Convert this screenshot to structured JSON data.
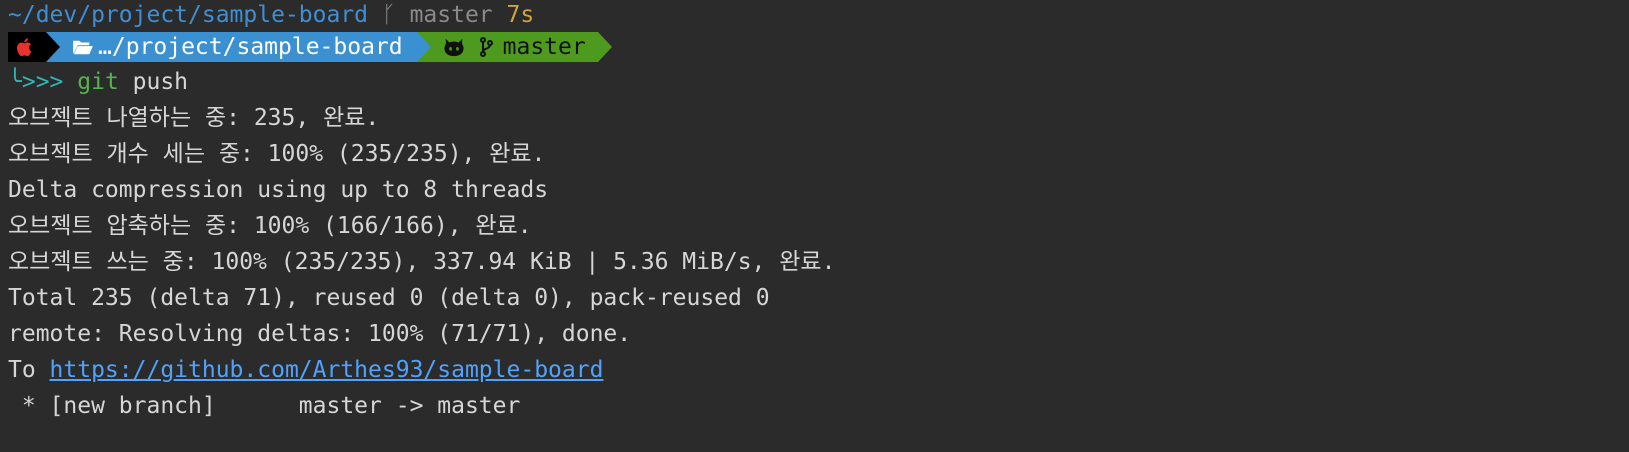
{
  "header": {
    "cwd": "~/dev/project/sample-board",
    "branch_icon": "git-branch-icon",
    "branch": "master",
    "duration": "7s"
  },
  "prompt": {
    "apple_icon": "apple-icon",
    "path_icon": "folder-open-icon",
    "path": "…/project/sample-board",
    "git_icon": "github-octocat-icon",
    "branch_icon": "git-branch-icon",
    "branch": "master",
    "colors": {
      "apple_bg": "#000000",
      "path_bg": "#3b90d1",
      "git_bg": "#4e9a1f"
    }
  },
  "command": {
    "prefix": "╰>>>",
    "cmd": "git",
    "args": " push"
  },
  "output": {
    "l1": "오브젝트 나열하는 중: 235, 완료.",
    "l2": "오브젝트 개수 세는 중: 100% (235/235), 완료.",
    "l3": "Delta compression using up to 8 threads",
    "l4": "오브젝트 압축하는 중: 100% (166/166), 완료.",
    "l5": "오브젝트 쓰는 중: 100% (235/235), 337.94 KiB | 5.36 MiB/s, 완료.",
    "l6": "Total 235 (delta 71), reused 0 (delta 0), pack-reused 0",
    "l7": "remote: Resolving deltas: 100% (71/71), done.",
    "to_label": "To ",
    "to_url": "https://github.com/Arthes93/sample-board",
    "l9": " * [new branch]      master -> master"
  }
}
